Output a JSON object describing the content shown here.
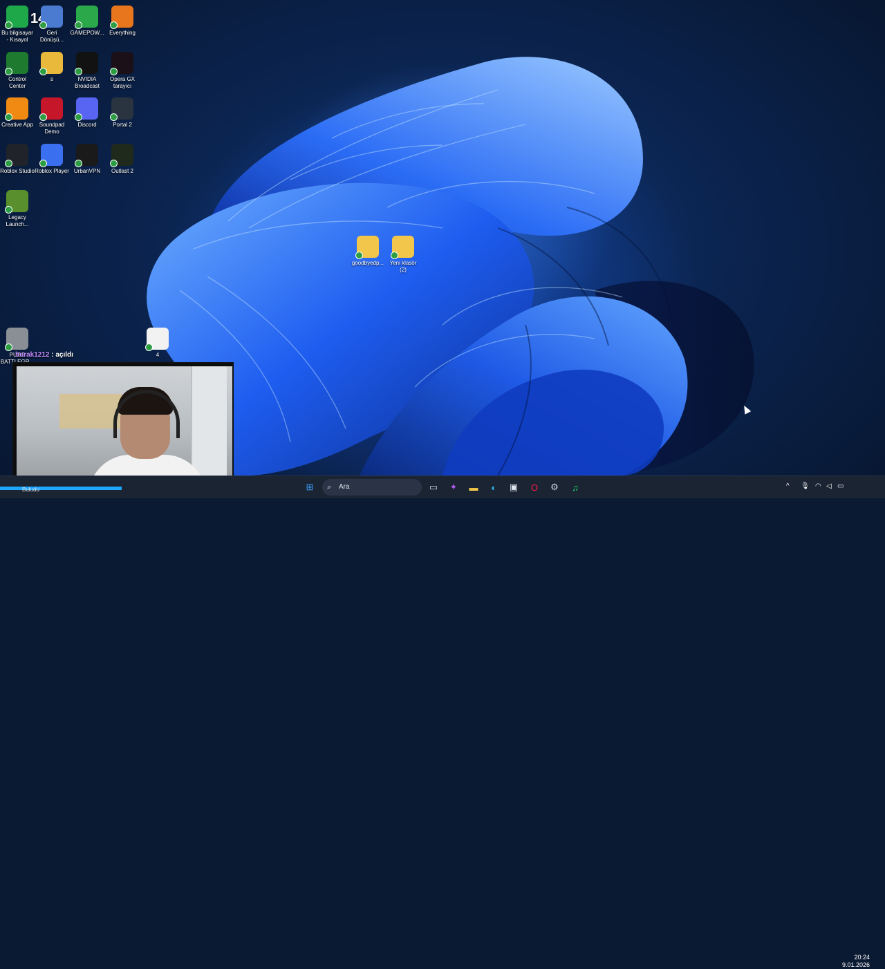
{
  "overlay": {
    "counter": "144",
    "chat_user": "burak1212",
    "chat_message": " : açıldı"
  },
  "desktop_icons": [
    {
      "label": "Bu bilgisayar - Kısayol",
      "icon": "this-pc-icon",
      "color": "#1fa84a"
    },
    {
      "label": "Geri Dönüşü...",
      "icon": "recycle-bin-icon",
      "color": "#4b7bd1"
    },
    {
      "label": "GAMEPOW...",
      "icon": "gamepower-icon",
      "color": "#2aa84a"
    },
    {
      "label": "Everything",
      "icon": "everything-search-icon",
      "color": "#e8761c"
    },
    {
      "label": "Control Center",
      "icon": "control-center-icon",
      "color": "#1e7a2f"
    },
    {
      "label": "s",
      "icon": "folder-icon",
      "color": "#e8b93a"
    },
    {
      "label": "NVIDIA Broadcast",
      "icon": "nvidia-broadcast-icon",
      "color": "#121212"
    },
    {
      "label": "Opera GX tarayıcı",
      "icon": "opera-gx-icon",
      "color": "#1b0f18"
    },
    {
      "label": "Creative App",
      "icon": "creative-app-icon",
      "color": "#f08a12"
    },
    {
      "label": "Soundpad Demo",
      "icon": "soundpad-icon",
      "color": "#c6162a"
    },
    {
      "label": "Discord",
      "icon": "discord-icon",
      "color": "#5865f2"
    },
    {
      "label": "Portal 2",
      "icon": "portal2-icon",
      "color": "#2a3440"
    },
    {
      "label": "Roblox Studio",
      "icon": "roblox-studio-icon",
      "color": "#20232a"
    },
    {
      "label": "Roblox Player",
      "icon": "roblox-player-icon",
      "color": "#3a6ff0"
    },
    {
      "label": "UrbanVPN",
      "icon": "urbanvpn-icon",
      "color": "#1a1a1a"
    },
    {
      "label": "Outlast 2",
      "icon": "outlast2-icon",
      "color": "#1f2a1c"
    },
    {
      "label": "Legacy Launch...",
      "icon": "minecraft-legacy-icon",
      "color": "#5a8f2e"
    },
    {
      "label": "PUBG BATTLEGR...",
      "icon": "pubg-icon",
      "color": "#8a8f96"
    },
    {
      "label": "goodbyedp...",
      "icon": "folder-icon",
      "color": "#f1c64a"
    },
    {
      "label": "Yeni klasör (2)",
      "icon": "folder-icon",
      "color": "#f1c64a"
    },
    {
      "label": "4",
      "icon": "text-file-icon",
      "color": "#f2f2f2"
    }
  ],
  "taskbar": {
    "search_placeholder": "Ara",
    "progress_label": "Buludu",
    "progress": 0.55,
    "progress_color": "#1ea7ff",
    "clock_time": "20:24",
    "clock_date": "9.01.2026",
    "items": [
      {
        "icon": "windows-start-icon",
        "color": "#3aa0ff",
        "glyph": "⊞"
      },
      {
        "icon": "widgets-icon",
        "color": "#7ea34b",
        "glyph": "▦"
      },
      {
        "icon": "task-view-icon",
        "color": "#cfd6e2",
        "glyph": "▭"
      },
      {
        "icon": "copilot-icon",
        "color": "#b05cf2",
        "glyph": "✦"
      },
      {
        "icon": "file-explorer-icon",
        "color": "#f1c64a",
        "glyph": "▬"
      },
      {
        "icon": "edge-icon",
        "color": "#2fb4e8",
        "glyph": "◐"
      },
      {
        "icon": "microsoft-store-icon",
        "color": "#dfe5ef",
        "glyph": "▣"
      },
      {
        "icon": "opera-gx-icon",
        "color": "#ff1b47",
        "glyph": "O"
      },
      {
        "icon": "steam-icon",
        "color": "#cfd6e2",
        "glyph": "⚙"
      },
      {
        "icon": "spotify-icon",
        "color": "#1ed760",
        "glyph": "♫"
      }
    ],
    "tray": [
      {
        "icon": "chevron-up-icon",
        "glyph": "^"
      },
      {
        "icon": "microphone-icon",
        "glyph": "🎙"
      },
      {
        "icon": "wifi-icon",
        "glyph": "◠"
      },
      {
        "icon": "volume-icon",
        "glyph": "◁"
      },
      {
        "icon": "battery-icon",
        "glyph": "▭"
      }
    ]
  }
}
